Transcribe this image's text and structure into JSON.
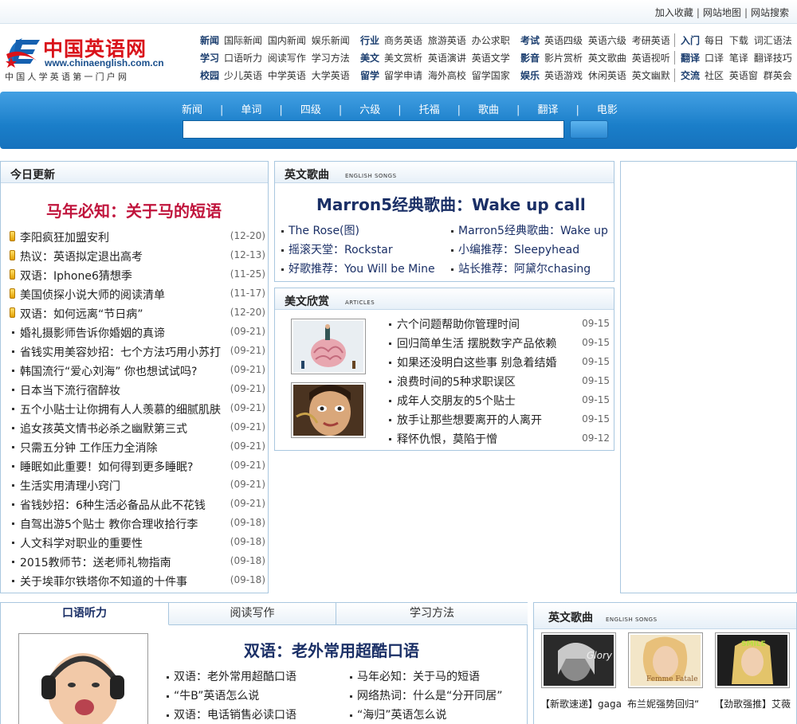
{
  "toplinks": [
    "加入收藏",
    "网站地图",
    "网站搜索"
  ],
  "logo": {
    "cn": "中国英语网",
    "url": "www.chinaenglish.com.cn",
    "slogan": "中国人学英语第一门户网"
  },
  "nav": [
    [
      {
        "head": "新闻",
        "links": [
          "国际新闻",
          "国内新闻",
          "娱乐新闻"
        ]
      },
      {
        "head": "行业",
        "links": [
          "商务英语",
          "旅游英语",
          "办公求职"
        ]
      },
      {
        "head": "考试",
        "links": [
          "英语四级",
          "英语六级",
          "考研英语"
        ]
      },
      {
        "head": "入门",
        "links": [
          "每日",
          "下载",
          "词汇语法"
        ]
      }
    ],
    [
      {
        "head": "学习",
        "links": [
          "口语听力",
          "阅读写作",
          "学习方法"
        ]
      },
      {
        "head": "美文",
        "links": [
          "美文赏析",
          "英语演讲",
          "英语文学"
        ]
      },
      {
        "head": "影音",
        "links": [
          "影片赏析",
          "英文歌曲",
          "英语视听"
        ]
      },
      {
        "head": "翻译",
        "links": [
          "口译",
          "笔译",
          "翻译技巧"
        ]
      }
    ],
    [
      {
        "head": "校园",
        "links": [
          "少儿英语",
          "中学英语",
          "大学英语"
        ]
      },
      {
        "head": "留学",
        "links": [
          "留学申请",
          "海外高校",
          "留学国家"
        ]
      },
      {
        "head": "娱乐",
        "links": [
          "英语游戏",
          "休闲英语",
          "英文幽默"
        ]
      },
      {
        "head": "交流",
        "links": [
          "社区",
          "英语窗",
          "群英会"
        ]
      }
    ]
  ],
  "bandnav": [
    "新闻",
    "单词",
    "四级",
    "六级",
    "托福",
    "歌曲",
    "翻译",
    "电影"
  ],
  "today": {
    "title": "今日更新",
    "headline": "马年必知：关于马的短语",
    "items": [
      {
        "t": "李阳疯狂加盟安利",
        "d": "(12-20)",
        "hot": true
      },
      {
        "t": "热议：英语拟定退出高考",
        "d": "(12-13)",
        "hot": true
      },
      {
        "t": "双语：Iphone6猜想季",
        "d": "(11-25)",
        "hot": true
      },
      {
        "t": "美国侦探小说大师的阅读清单",
        "d": "(11-17)",
        "hot": true
      },
      {
        "t": "双语：如何远离“节日病”",
        "d": "(12-20)",
        "hot": true
      },
      {
        "t": "婚礼摄影师告诉你婚姻的真谛",
        "d": "(09-21)",
        "hot": false
      },
      {
        "t": "省钱实用美容妙招：七个方法巧用小苏打",
        "d": "(09-21)",
        "hot": false
      },
      {
        "t": "韩国流行“爱心刘海” 你也想试试吗?",
        "d": "(09-21)",
        "hot": false
      },
      {
        "t": "日本当下流行宿醉妆",
        "d": "(09-21)",
        "hot": false
      },
      {
        "t": "五个小贴士让你拥有人人羡慕的细腻肌肤",
        "d": "(09-21)",
        "hot": false
      },
      {
        "t": "追女孩英文情书必杀之幽默第三式",
        "d": "(09-21)",
        "hot": false
      },
      {
        "t": "只需五分钟 工作压力全消除",
        "d": "(09-21)",
        "hot": false
      },
      {
        "t": "睡眠如此重要！如何得到更多睡眠?",
        "d": "(09-21)",
        "hot": false
      },
      {
        "t": "生活实用清理小窍门",
        "d": "(09-21)",
        "hot": false
      },
      {
        "t": "省钱妙招：6种生活必备品从此不花钱",
        "d": "(09-21)",
        "hot": false
      },
      {
        "t": "自驾出游5个贴士 教你合理收拾行李",
        "d": "(09-18)",
        "hot": false
      },
      {
        "t": "人文科学对职业的重要性",
        "d": "(09-18)",
        "hot": false
      },
      {
        "t": "2015教师节：送老师礼物指南",
        "d": "(09-18)",
        "hot": false
      },
      {
        "t": "关于埃菲尔铁塔你不知道的十件事",
        "d": "(09-18)",
        "hot": false
      }
    ]
  },
  "songs": {
    "title": "英文歌曲",
    "sub": "ENGLISH SONGS",
    "headline": "Marron5经典歌曲：Wake up call",
    "left": [
      "The Rose(图)",
      "摇滚天堂：Rockstar",
      "好歌推荐：You Will be Mine"
    ],
    "right": [
      "Marron5经典歌曲：Wake up",
      "小编推荐：Sleepyhead",
      "站长推荐：阿黛尔chasing"
    ]
  },
  "articles": {
    "title": "美文欣赏",
    "sub": "ARTICLES",
    "items": [
      {
        "t": "六个问题帮助你管理时间",
        "d": "09-15"
      },
      {
        "t": "回归简单生活 摆脱数字产品依赖",
        "d": "09-15"
      },
      {
        "t": "如果还没明白这些事 别急着结婚",
        "d": "09-15"
      },
      {
        "t": "浪费时间的5种求职误区",
        "d": "09-15"
      },
      {
        "t": "成年人交朋友的5个贴士",
        "d": "09-15"
      },
      {
        "t": "放手让那些想要离开的人离开",
        "d": "09-15"
      },
      {
        "t": "释怀仇恨，莫陷于憎",
        "d": "09-12"
      }
    ]
  },
  "bottomtabs": [
    "口语听力",
    "阅读写作",
    "学习方法"
  ],
  "oral": {
    "headline": "双语：老外常用超酷口语",
    "left": [
      "双语：老外常用超酷口语",
      "“牛B”英语怎么说",
      "双语：电话销售必读口语"
    ],
    "right": [
      "马年必知：关于马的短语",
      "网络热词：什么是“分开同居”",
      "“海归”英语怎么说"
    ]
  },
  "songs2": {
    "title": "英文歌曲",
    "sub": "ENGLISH SONGS",
    "captions": [
      "【新歌速递】gaga",
      "布兰妮强势回归“",
      "【劲歌强推】艾薇"
    ]
  }
}
